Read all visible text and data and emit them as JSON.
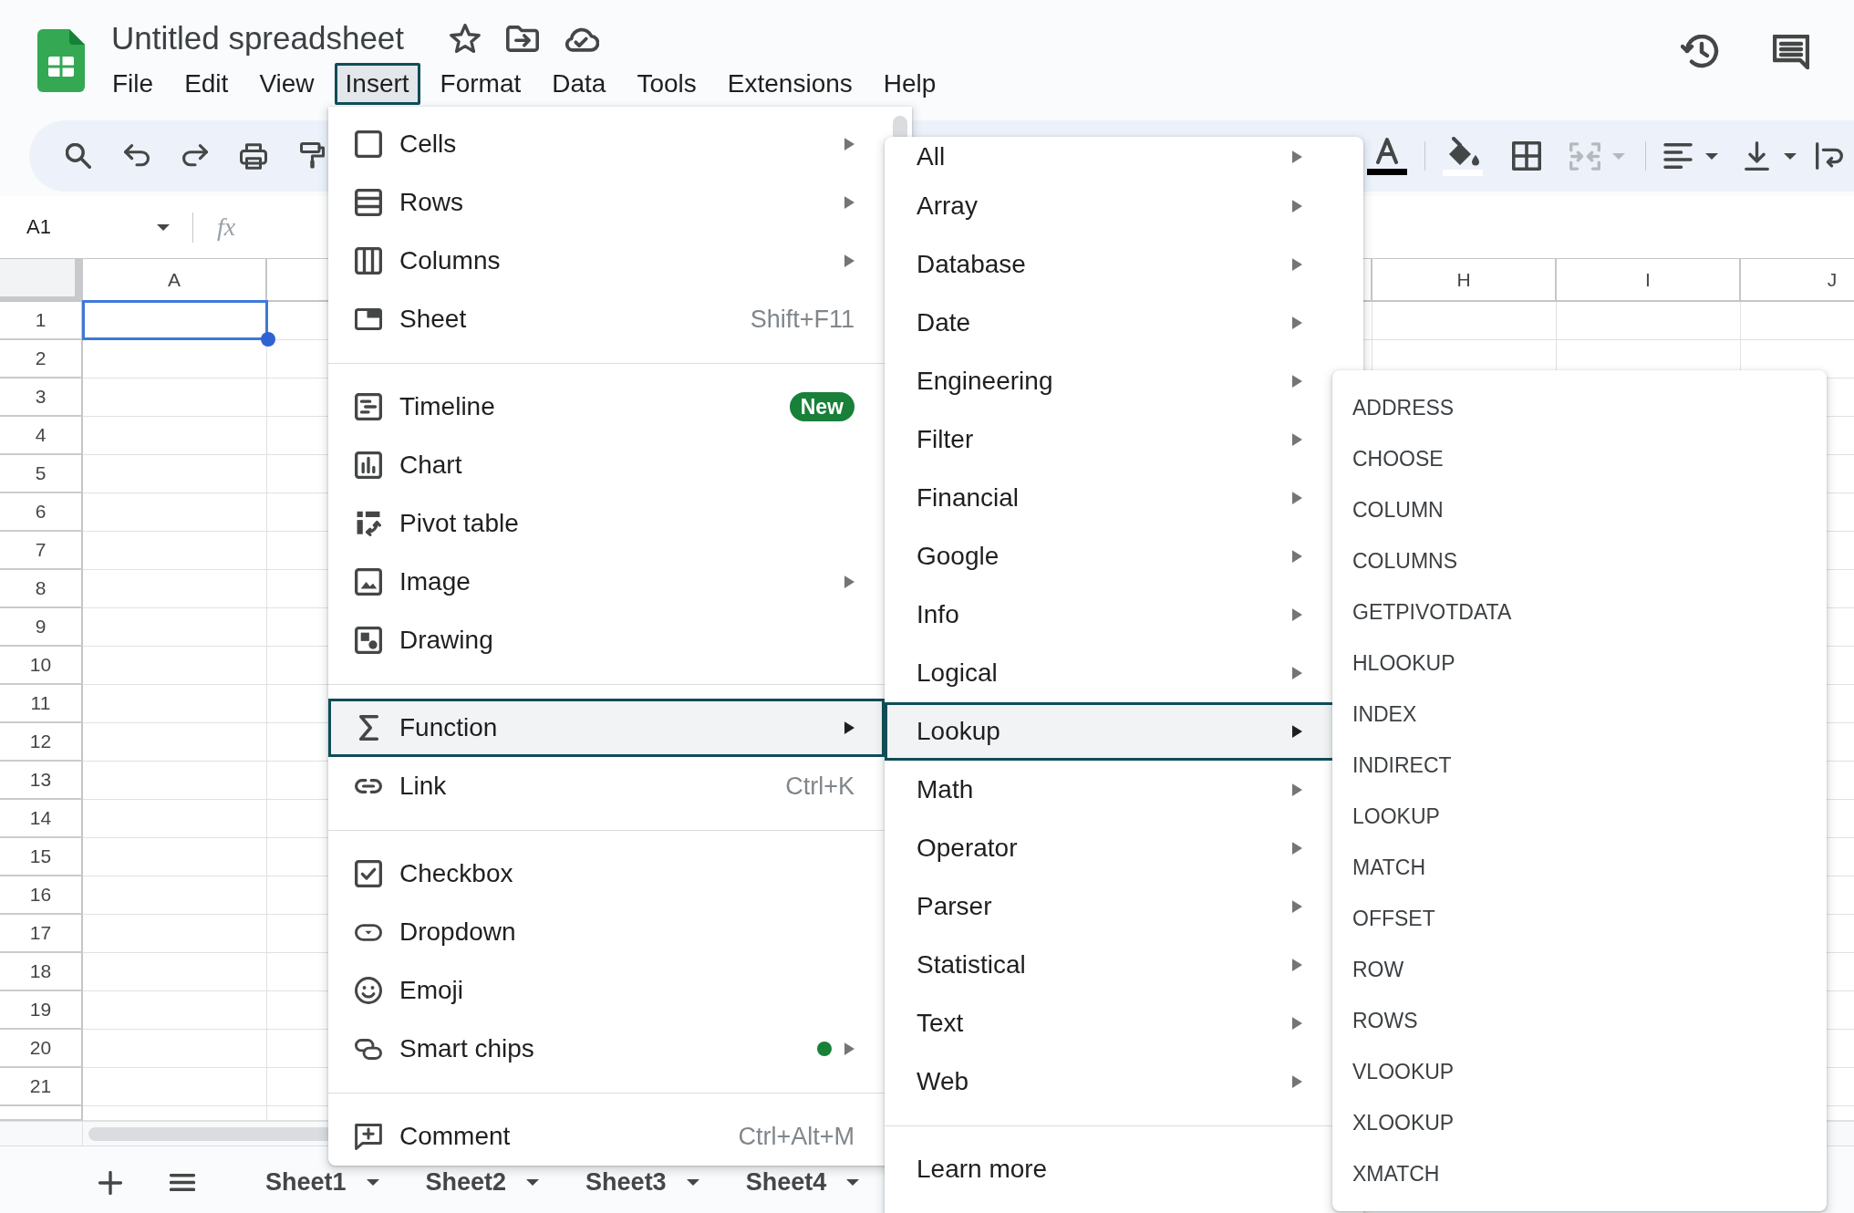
{
  "document": {
    "title": "Untitled spreadsheet"
  },
  "menu_bar": [
    {
      "label": "File",
      "selected": false
    },
    {
      "label": "Edit",
      "selected": false
    },
    {
      "label": "View",
      "selected": false
    },
    {
      "label": "Insert",
      "selected": true
    },
    {
      "label": "Format",
      "selected": false
    },
    {
      "label": "Data",
      "selected": false
    },
    {
      "label": "Tools",
      "selected": false
    },
    {
      "label": "Extensions",
      "selected": false
    },
    {
      "label": "Help",
      "selected": false
    }
  ],
  "toolbar": {
    "merge": {
      "disabled": true
    }
  },
  "name_box": {
    "value": "A1"
  },
  "formula_bar": {
    "label": "fx"
  },
  "grid": {
    "columns": [
      {
        "label": "A"
      },
      {
        "label": "H"
      },
      {
        "label": "I"
      },
      {
        "label": "J"
      }
    ],
    "rows": [
      {
        "label": "1",
        "selected": true
      },
      {
        "label": "2",
        "selected": false
      },
      {
        "label": "3",
        "selected": false
      },
      {
        "label": "4",
        "selected": false
      },
      {
        "label": "5",
        "selected": false
      },
      {
        "label": "6",
        "selected": false
      },
      {
        "label": "7",
        "selected": false
      },
      {
        "label": "8",
        "selected": false
      },
      {
        "label": "9",
        "selected": false
      },
      {
        "label": "10",
        "selected": false
      },
      {
        "label": "11",
        "selected": false
      },
      {
        "label": "12",
        "selected": false
      },
      {
        "label": "13",
        "selected": false
      },
      {
        "label": "14",
        "selected": false
      },
      {
        "label": "15",
        "selected": false
      },
      {
        "label": "16",
        "selected": false
      },
      {
        "label": "17",
        "selected": false
      },
      {
        "label": "18",
        "selected": false
      },
      {
        "label": "19",
        "selected": false
      },
      {
        "label": "20",
        "selected": false
      },
      {
        "label": "21",
        "selected": false
      }
    ]
  },
  "sheet_tabs": [
    {
      "label": "Sheet1"
    },
    {
      "label": "Sheet2"
    },
    {
      "label": "Sheet3"
    },
    {
      "label": "Sheet4"
    }
  ],
  "insert_menu": {
    "sections": [
      {
        "items": [
          {
            "label": "Cells",
            "submenu": true,
            "dot": false,
            "selected": false
          },
          {
            "label": "Rows",
            "submenu": true,
            "dot": false,
            "selected": false
          },
          {
            "label": "Columns",
            "submenu": true,
            "dot": false,
            "selected": false
          },
          {
            "label": "Sheet",
            "shortcut": "Shift+F11",
            "submenu": false,
            "dot": false,
            "selected": false
          }
        ]
      },
      {
        "items": [
          {
            "label": "Timeline",
            "badge": "New",
            "submenu": false,
            "dot": false,
            "selected": false
          },
          {
            "label": "Chart",
            "submenu": false,
            "dot": false,
            "selected": false
          },
          {
            "label": "Pivot table",
            "submenu": false,
            "dot": false,
            "selected": false
          },
          {
            "label": "Image",
            "submenu": true,
            "dot": false,
            "selected": false
          },
          {
            "label": "Drawing",
            "submenu": false,
            "dot": false,
            "selected": false
          }
        ]
      },
      {
        "items": [
          {
            "label": "Function",
            "submenu": true,
            "dot": false,
            "selected": true
          },
          {
            "label": "Link",
            "shortcut": "Ctrl+K",
            "submenu": false,
            "dot": false,
            "selected": false
          }
        ]
      },
      {
        "items": [
          {
            "label": "Checkbox",
            "submenu": false,
            "dot": false,
            "selected": false
          },
          {
            "label": "Dropdown",
            "submenu": false,
            "dot": false,
            "selected": false
          },
          {
            "label": "Emoji",
            "submenu": false,
            "dot": false,
            "selected": false
          },
          {
            "label": "Smart chips",
            "submenu": true,
            "dot": true,
            "selected": false
          }
        ]
      },
      {
        "items": [
          {
            "label": "Comment",
            "shortcut": "Ctrl+Alt+M",
            "submenu": false,
            "dot": false,
            "selected": false
          }
        ]
      }
    ]
  },
  "function_categories": {
    "items": [
      {
        "label": "All",
        "submenu": true,
        "selected": false
      },
      {
        "label": "Array",
        "submenu": true,
        "selected": false
      },
      {
        "label": "Database",
        "submenu": true,
        "selected": false
      },
      {
        "label": "Date",
        "submenu": true,
        "selected": false
      },
      {
        "label": "Engineering",
        "submenu": true,
        "selected": false
      },
      {
        "label": "Filter",
        "submenu": true,
        "selected": false
      },
      {
        "label": "Financial",
        "submenu": true,
        "selected": false
      },
      {
        "label": "Google",
        "submenu": true,
        "selected": false
      },
      {
        "label": "Info",
        "submenu": true,
        "selected": false
      },
      {
        "label": "Logical",
        "submenu": true,
        "selected": false
      },
      {
        "label": "Lookup",
        "submenu": true,
        "selected": true
      },
      {
        "label": "Math",
        "submenu": true,
        "selected": false
      },
      {
        "label": "Operator",
        "submenu": true,
        "selected": false
      },
      {
        "label": "Parser",
        "submenu": true,
        "selected": false
      },
      {
        "label": "Statistical",
        "submenu": true,
        "selected": false
      },
      {
        "label": "Text",
        "submenu": true,
        "selected": false
      },
      {
        "label": "Web",
        "submenu": true,
        "selected": false
      }
    ],
    "link": "Learn more"
  },
  "lookup_functions": {
    "items": [
      "ADDRESS",
      "CHOOSE",
      "COLUMN",
      "COLUMNS",
      "GETPIVOTDATA",
      "HLOOKUP",
      "INDEX",
      "INDIRECT",
      "LOOKUP",
      "MATCH",
      "OFFSET",
      "ROW",
      "ROWS",
      "VLOOKUP",
      "XLOOKUP",
      "XMATCH"
    ]
  }
}
